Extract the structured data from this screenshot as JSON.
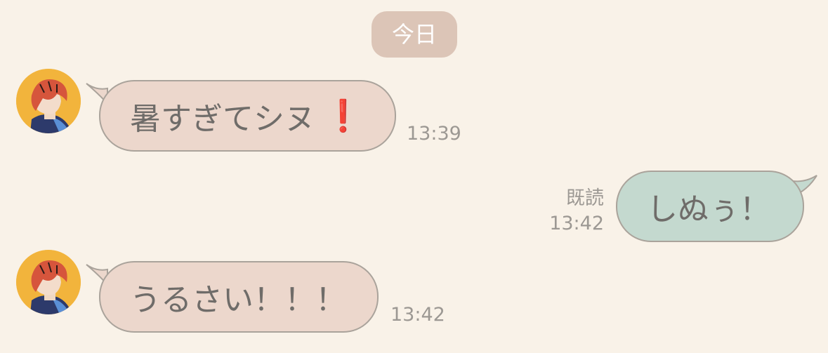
{
  "chat": {
    "date_label": "今日",
    "messages": [
      {
        "direction": "incoming",
        "text": "暑すぎてシヌ",
        "emoji": "❗",
        "time": "13:39"
      },
      {
        "direction": "outgoing",
        "text": "しぬぅ！",
        "read_label": "既読",
        "time": "13:42"
      },
      {
        "direction": "incoming",
        "text": "うるさい！！！",
        "time": "13:42"
      }
    ]
  },
  "colors": {
    "background": "#f9f2e8",
    "date_pill": "#dcc5b7",
    "incoming_bubble": "#ecd7cc",
    "outgoing_bubble": "#c4d9cf",
    "bubble_border": "#aaa39b",
    "meta_text": "#9c9893",
    "emoji_red": "#d22a2a",
    "avatar_bg": "#f2b43c"
  },
  "icons": {
    "avatar": "avatar-illustration-icon",
    "emoji": "red-exclamation-icon"
  }
}
